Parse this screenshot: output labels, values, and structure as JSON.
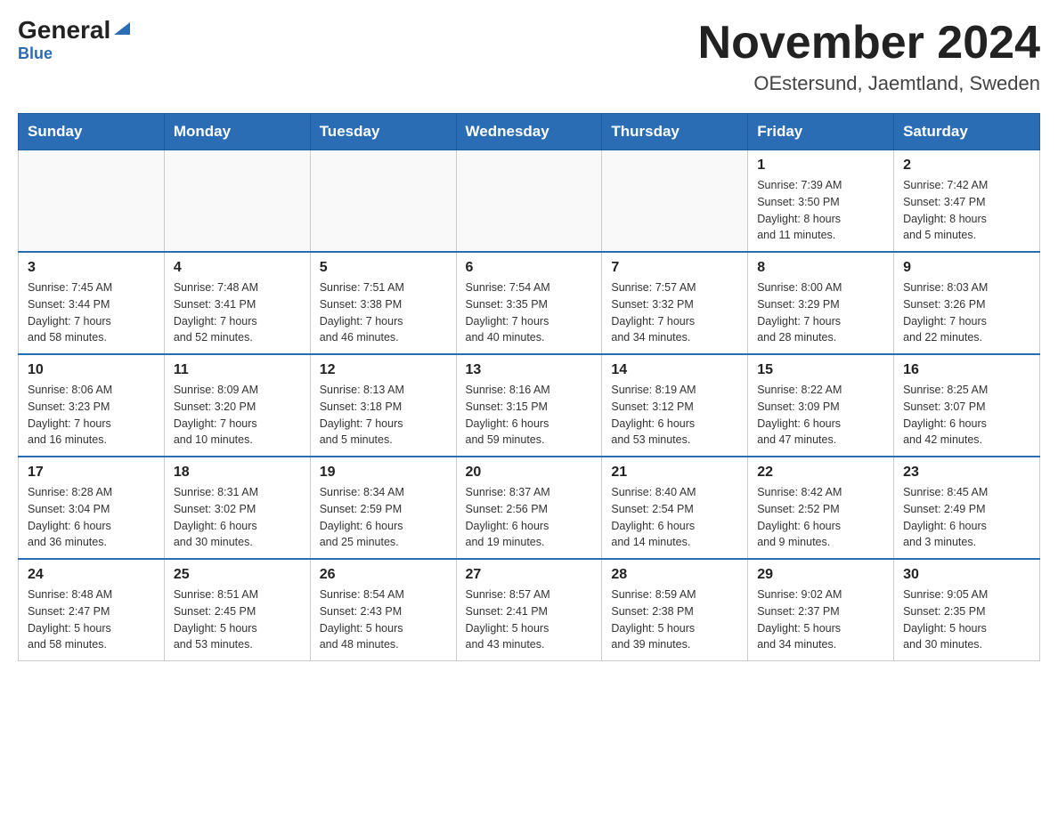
{
  "logo": {
    "general": "General",
    "blue": "Blue"
  },
  "title": "November 2024",
  "subtitle": "OEstersund, Jaemtland, Sweden",
  "weekdays": [
    "Sunday",
    "Monday",
    "Tuesday",
    "Wednesday",
    "Thursday",
    "Friday",
    "Saturday"
  ],
  "weeks": [
    [
      {
        "day": "",
        "info": ""
      },
      {
        "day": "",
        "info": ""
      },
      {
        "day": "",
        "info": ""
      },
      {
        "day": "",
        "info": ""
      },
      {
        "day": "",
        "info": ""
      },
      {
        "day": "1",
        "info": "Sunrise: 7:39 AM\nSunset: 3:50 PM\nDaylight: 8 hours\nand 11 minutes."
      },
      {
        "day": "2",
        "info": "Sunrise: 7:42 AM\nSunset: 3:47 PM\nDaylight: 8 hours\nand 5 minutes."
      }
    ],
    [
      {
        "day": "3",
        "info": "Sunrise: 7:45 AM\nSunset: 3:44 PM\nDaylight: 7 hours\nand 58 minutes."
      },
      {
        "day": "4",
        "info": "Sunrise: 7:48 AM\nSunset: 3:41 PM\nDaylight: 7 hours\nand 52 minutes."
      },
      {
        "day": "5",
        "info": "Sunrise: 7:51 AM\nSunset: 3:38 PM\nDaylight: 7 hours\nand 46 minutes."
      },
      {
        "day": "6",
        "info": "Sunrise: 7:54 AM\nSunset: 3:35 PM\nDaylight: 7 hours\nand 40 minutes."
      },
      {
        "day": "7",
        "info": "Sunrise: 7:57 AM\nSunset: 3:32 PM\nDaylight: 7 hours\nand 34 minutes."
      },
      {
        "day": "8",
        "info": "Sunrise: 8:00 AM\nSunset: 3:29 PM\nDaylight: 7 hours\nand 28 minutes."
      },
      {
        "day": "9",
        "info": "Sunrise: 8:03 AM\nSunset: 3:26 PM\nDaylight: 7 hours\nand 22 minutes."
      }
    ],
    [
      {
        "day": "10",
        "info": "Sunrise: 8:06 AM\nSunset: 3:23 PM\nDaylight: 7 hours\nand 16 minutes."
      },
      {
        "day": "11",
        "info": "Sunrise: 8:09 AM\nSunset: 3:20 PM\nDaylight: 7 hours\nand 10 minutes."
      },
      {
        "day": "12",
        "info": "Sunrise: 8:13 AM\nSunset: 3:18 PM\nDaylight: 7 hours\nand 5 minutes."
      },
      {
        "day": "13",
        "info": "Sunrise: 8:16 AM\nSunset: 3:15 PM\nDaylight: 6 hours\nand 59 minutes."
      },
      {
        "day": "14",
        "info": "Sunrise: 8:19 AM\nSunset: 3:12 PM\nDaylight: 6 hours\nand 53 minutes."
      },
      {
        "day": "15",
        "info": "Sunrise: 8:22 AM\nSunset: 3:09 PM\nDaylight: 6 hours\nand 47 minutes."
      },
      {
        "day": "16",
        "info": "Sunrise: 8:25 AM\nSunset: 3:07 PM\nDaylight: 6 hours\nand 42 minutes."
      }
    ],
    [
      {
        "day": "17",
        "info": "Sunrise: 8:28 AM\nSunset: 3:04 PM\nDaylight: 6 hours\nand 36 minutes."
      },
      {
        "day": "18",
        "info": "Sunrise: 8:31 AM\nSunset: 3:02 PM\nDaylight: 6 hours\nand 30 minutes."
      },
      {
        "day": "19",
        "info": "Sunrise: 8:34 AM\nSunset: 2:59 PM\nDaylight: 6 hours\nand 25 minutes."
      },
      {
        "day": "20",
        "info": "Sunrise: 8:37 AM\nSunset: 2:56 PM\nDaylight: 6 hours\nand 19 minutes."
      },
      {
        "day": "21",
        "info": "Sunrise: 8:40 AM\nSunset: 2:54 PM\nDaylight: 6 hours\nand 14 minutes."
      },
      {
        "day": "22",
        "info": "Sunrise: 8:42 AM\nSunset: 2:52 PM\nDaylight: 6 hours\nand 9 minutes."
      },
      {
        "day": "23",
        "info": "Sunrise: 8:45 AM\nSunset: 2:49 PM\nDaylight: 6 hours\nand 3 minutes."
      }
    ],
    [
      {
        "day": "24",
        "info": "Sunrise: 8:48 AM\nSunset: 2:47 PM\nDaylight: 5 hours\nand 58 minutes."
      },
      {
        "day": "25",
        "info": "Sunrise: 8:51 AM\nSunset: 2:45 PM\nDaylight: 5 hours\nand 53 minutes."
      },
      {
        "day": "26",
        "info": "Sunrise: 8:54 AM\nSunset: 2:43 PM\nDaylight: 5 hours\nand 48 minutes."
      },
      {
        "day": "27",
        "info": "Sunrise: 8:57 AM\nSunset: 2:41 PM\nDaylight: 5 hours\nand 43 minutes."
      },
      {
        "day": "28",
        "info": "Sunrise: 8:59 AM\nSunset: 2:38 PM\nDaylight: 5 hours\nand 39 minutes."
      },
      {
        "day": "29",
        "info": "Sunrise: 9:02 AM\nSunset: 2:37 PM\nDaylight: 5 hours\nand 34 minutes."
      },
      {
        "day": "30",
        "info": "Sunrise: 9:05 AM\nSunset: 2:35 PM\nDaylight: 5 hours\nand 30 minutes."
      }
    ]
  ]
}
